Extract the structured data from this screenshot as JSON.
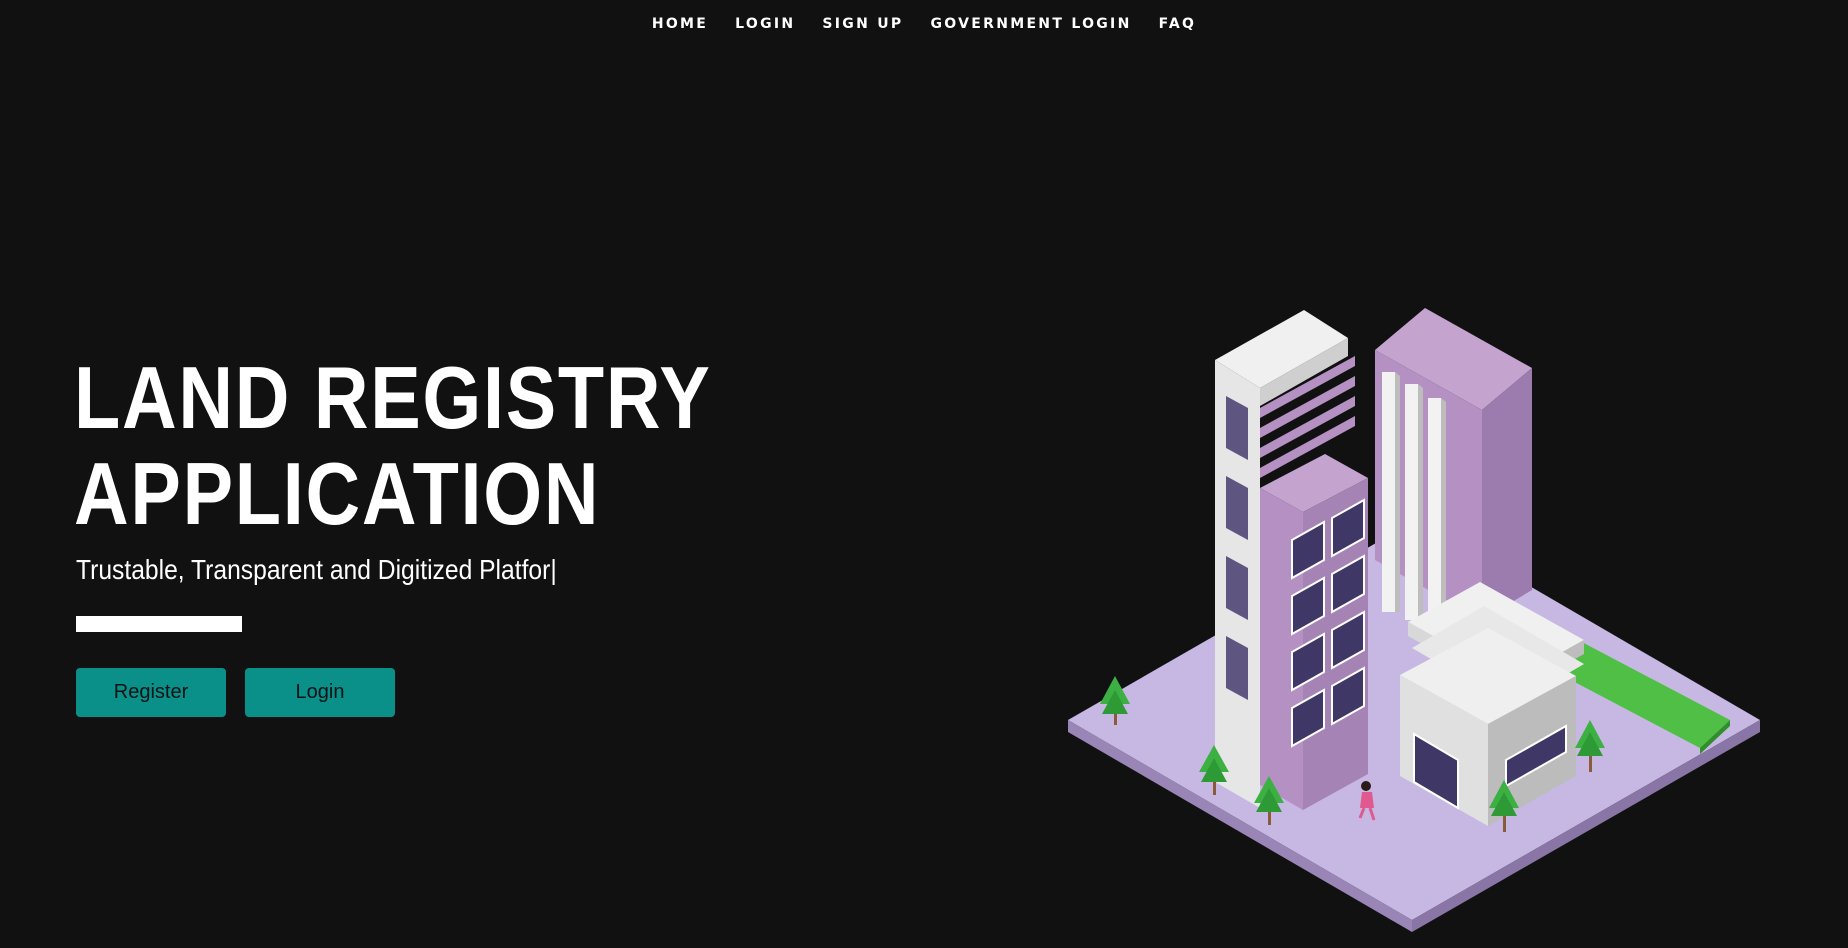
{
  "nav": {
    "items": [
      "HOME",
      "LOGIN",
      "SIGN UP",
      "GOVERNMENT LOGIN",
      "FAQ"
    ]
  },
  "hero": {
    "title_line1": "LAND REGISTRY",
    "title_line2": "APPLICATION",
    "subtitle": "Trustable, Transparent and Digitized Platfor|",
    "register_label": "Register",
    "login_label": "Login"
  },
  "colors": {
    "background": "#111111",
    "accent": "#0a8f89",
    "text": "#ffffff",
    "building_purple": "#a98bb8",
    "ground_lavender": "#c6b8e2",
    "lawn_green": "#4fbf45"
  }
}
